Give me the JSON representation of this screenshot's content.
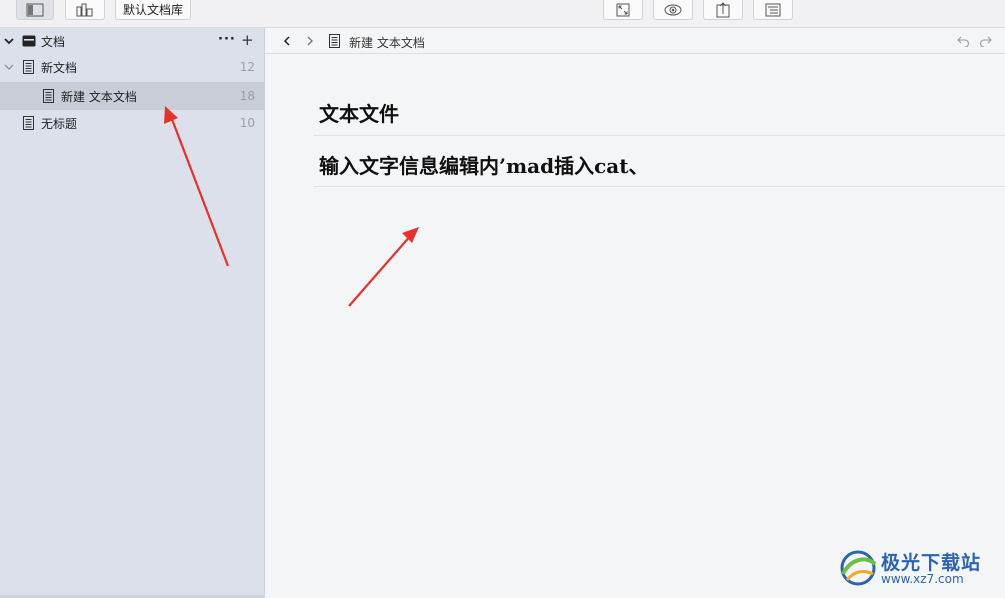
{
  "toolbar": {
    "library_label": "默认文档库"
  },
  "sidebar": {
    "root": {
      "label": "文档",
      "more_icon": "more-icon",
      "add_icon": "plus-icon"
    },
    "items": [
      {
        "label": "新文档",
        "count": "12",
        "icon": "document-icon"
      },
      {
        "label": "新建 文本文档",
        "count": "18",
        "icon": "document-icon"
      },
      {
        "label": "无标题",
        "count": "10",
        "icon": "document-icon"
      }
    ]
  },
  "main": {
    "breadcrumb": "新建 文本文档",
    "lines": [
      "文本文件",
      "输入文字信息编辑内’mad插入cat、"
    ]
  },
  "watermark": {
    "title": "极光下载站",
    "url": "www.xz7.com"
  },
  "colors": {
    "sidebar_bg": "#dbe0ea",
    "selected_bg": "#c8cdd7",
    "annotation_arrow": "#e8312a",
    "watermark_blue": "#2a63b5"
  }
}
